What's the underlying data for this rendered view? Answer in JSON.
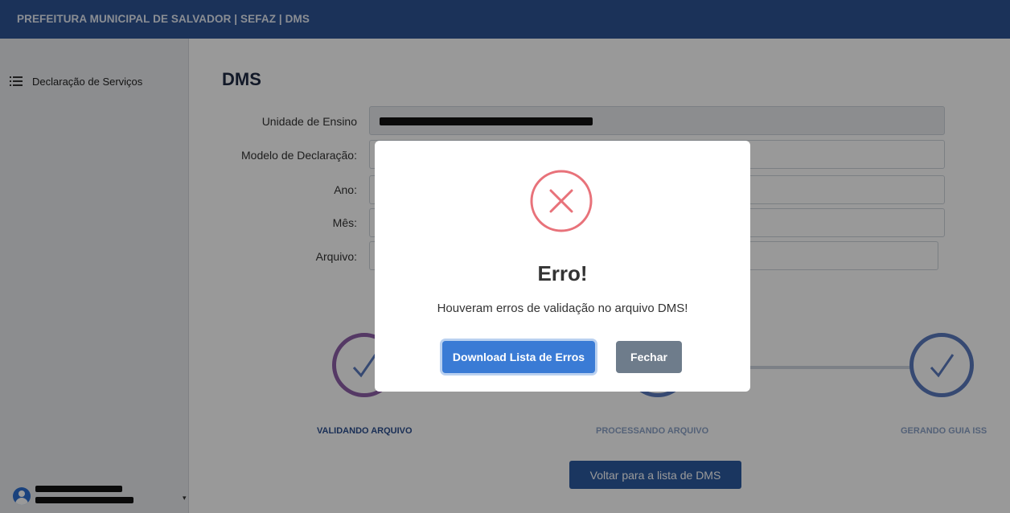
{
  "header": {
    "title": "PREFEITURA MUNICIPAL DE SALVADOR | SEFAZ | DMS"
  },
  "sidebar": {
    "items": [
      {
        "label": "Declaração de Serviços",
        "icon": "list-icon"
      }
    ],
    "user": {
      "name": "",
      "icon": "user-avatar-icon"
    }
  },
  "main": {
    "heading": "DMS",
    "form": {
      "unidade_label": "Unidade de Ensino",
      "modelo_label": "Modelo de Declaração:",
      "ano_label": "Ano:",
      "mes_label": "Mês:",
      "arquivo_label": "Arquivo:"
    },
    "steps": [
      {
        "label": "VALIDANDO ARQUIVO",
        "status": "current"
      },
      {
        "label": "PROCESSANDO ARQUIVO",
        "status": "pending"
      },
      {
        "label": "GERANDO GUIA ISS",
        "status": "done"
      }
    ],
    "back_button": "Voltar para a lista de DMS"
  },
  "modal": {
    "icon": "error-x-icon",
    "title": "Erro!",
    "message": "Houveram erros de validação no arquivo DMS!",
    "download_button": "Download Lista de Erros",
    "close_button": "Fechar"
  },
  "colors": {
    "header_bg": "#2d5494",
    "primary_button": "#3a7bd5",
    "secondary_button": "#6e7c8b",
    "error": "#e8727a",
    "step_purple": "#8e5fa8",
    "step_blue": "#5a7bbf"
  }
}
